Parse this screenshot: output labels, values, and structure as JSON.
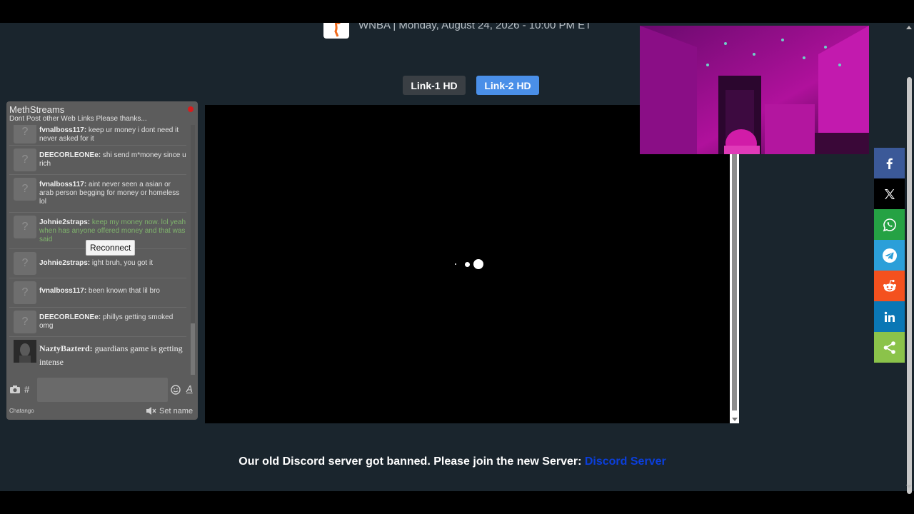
{
  "event": {
    "title": "WNBA | Monday, August 24, 2026 - 10:00 PM ET",
    "logo": "basketball-player-logo"
  },
  "links": [
    {
      "label": "Link-1 HD",
      "active": false
    },
    {
      "label": "Link-2 HD",
      "active": true
    }
  ],
  "chat": {
    "title": "MethStreams",
    "subtitle": "Dont Post other Web Links Please thanks...",
    "status_color": "#d61c1c",
    "messages": [
      {
        "user": "fvnalboss117:",
        "text": " keep ur money i dont need it never asked for it"
      },
      {
        "user": "DEECORLEONEe:",
        "text": " shi send m*money since u rich"
      },
      {
        "user": "fvnalboss117:",
        "text": " aint never seen a asian or arab person begging for money or homeless lol"
      },
      {
        "user": "Johnie2straps:",
        "text": " keep my money now. lol yeah when has anyone offered money and that was said"
      },
      {
        "user": "Johnie2straps:",
        "text": " ight bruh, you got it"
      },
      {
        "user": "fvnalboss117:",
        "text": " been known that lil bro"
      },
      {
        "user": "DEECORLEONEe:",
        "text": " phillys getting smoked omg"
      },
      {
        "user": "NaztyBazterd:",
        "text": " guardians game is getting intense"
      }
    ],
    "reconnect_label": "Reconnect",
    "hash_label": "#",
    "font_label": "A",
    "input_placeholder": "",
    "footer_brand": "Chatango",
    "set_name_label": "Set name"
  },
  "notice": {
    "text": "Our old Discord server got banned. Please join the new Server: ",
    "link_text": "Discord Server"
  },
  "share": [
    {
      "name": "facebook",
      "color": "#3b5998"
    },
    {
      "name": "x",
      "color": "#000000"
    },
    {
      "name": "whatsapp",
      "color": "#25a244"
    },
    {
      "name": "telegram",
      "color": "#2b9fd9"
    },
    {
      "name": "reddit",
      "color": "#f4511e"
    },
    {
      "name": "linkedin",
      "color": "#0a77b5"
    },
    {
      "name": "sharethis",
      "color": "#8bc34a"
    }
  ]
}
